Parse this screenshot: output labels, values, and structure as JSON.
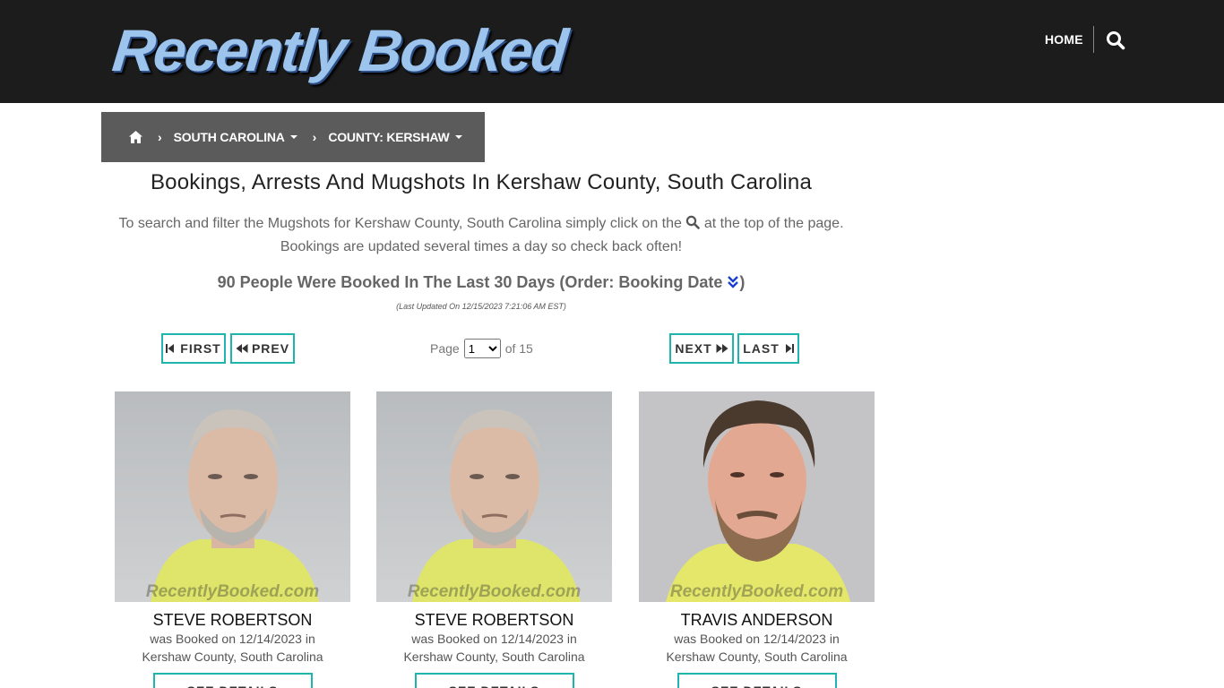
{
  "header": {
    "logo_text": "Recently Booked",
    "nav_home": "HOME",
    "search_icon": "search-icon"
  },
  "breadcrumb": {
    "home_icon": "home-icon",
    "items": [
      {
        "label": "SOUTH CAROLINA"
      },
      {
        "label": "COUNTY: KERSHAW"
      }
    ]
  },
  "page": {
    "title": "Bookings, Arrests And Mugshots In Kershaw County, South Carolina",
    "intro_before": "To search and filter the Mugshots for Kershaw County, South Carolina simply click on the",
    "intro_after": "at the top of the page. Bookings are updated several times a day so check back often!",
    "count_text": "90 People Were Booked In The Last 30 Days (Order: Booking Date",
    "count_close": ")",
    "last_updated": "(Last Updated On 12/15/2023 7:21:06 AM EST)"
  },
  "pager": {
    "first": "FIRST",
    "prev": "PREV",
    "next": "NEXT",
    "last": "LAST",
    "page_label": "Page",
    "current_page": "1",
    "of_label": "of 15"
  },
  "cards": [
    {
      "name": "STEVE ROBERTSON",
      "booked": "was Booked on 12/14/2023 in",
      "location": "Kershaw County, South Carolina",
      "watermark": "RecentlyBooked.com",
      "button": "SEE DETAILS"
    },
    {
      "name": "STEVE ROBERTSON",
      "booked": "was Booked on 12/14/2023 in",
      "location": "Kershaw County, South Carolina",
      "watermark": "RecentlyBooked.com",
      "button": "SEE DETAILS"
    },
    {
      "name": "TRAVIS ANDERSON",
      "booked": "was Booked on 12/14/2023 in",
      "location": "Kershaw County, South Carolina",
      "watermark": "RecentlyBooked.com",
      "button": "SEE DETAILS"
    }
  ],
  "colors": {
    "header_bg": "#1c1c1c",
    "breadcrumb_bg": "#5b5b5b",
    "accent": "#1fb5ad",
    "order_icon": "#1a3fd1"
  }
}
